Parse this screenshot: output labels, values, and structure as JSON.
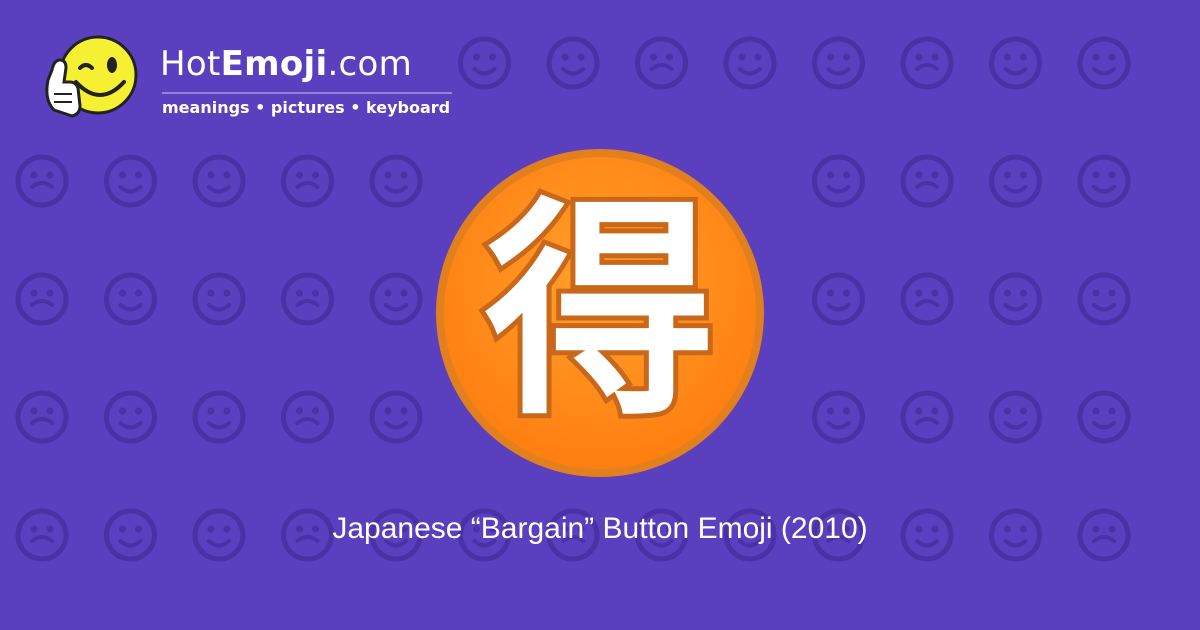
{
  "brand": {
    "prefix": "Hot",
    "strong": "Emoji",
    "suffix": ".com"
  },
  "tagline": "meanings • pictures • keyboard",
  "emoji": {
    "glyph": "得",
    "name": "japanese-bargain-button"
  },
  "caption": "Japanese “Bargain” Button Emoji (2010)",
  "background_icons": [
    "smile",
    "wink",
    "kiss",
    "hearts",
    "smile",
    "persevere",
    "ok-hand",
    "neutral",
    "eyes",
    "smirk",
    "relieved",
    "grimace",
    "recycle",
    "raised-hands",
    "notes",
    "sleeping",
    "frown",
    "grin",
    "sparkles",
    "grin",
    "heart",
    "broken-heart",
    "confused",
    "heart",
    "tongue",
    "frown",
    "broken-heart",
    "arrow-heart",
    "weary",
    "hearts",
    "heart",
    "monkey",
    "scream",
    "imp",
    "angry",
    "arrow-left",
    "fire",
    "grin",
    "sparkle",
    "tongue",
    "rose",
    "sun",
    "flex",
    "heart",
    "check",
    "laugh",
    "face",
    "cat",
    "wave",
    "mask",
    "camera",
    "frown",
    "heart",
    "grin",
    "heart-glow",
    "smile",
    "kiss"
  ],
  "colors": {
    "background": "#5a3fbf",
    "pattern": "#4a31a6",
    "emoji_orange": "#ff8f1f",
    "emoji_rim": "#d9751a",
    "logo_yellow": "#f5f032"
  }
}
